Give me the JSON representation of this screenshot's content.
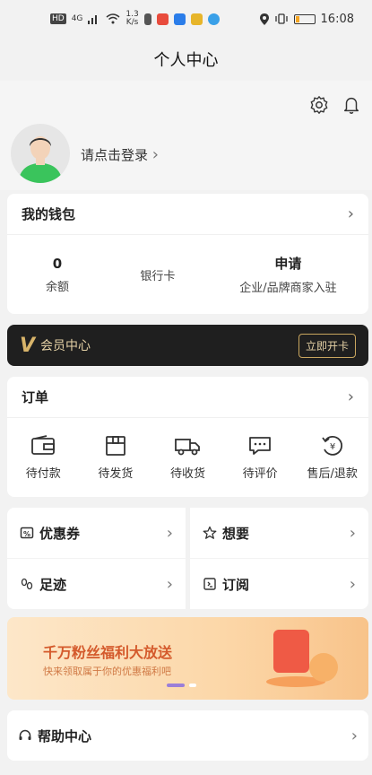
{
  "status": {
    "network": "HD",
    "signal": "4G",
    "speed_value": "1.3",
    "speed_unit": "K/s",
    "time": "16:08",
    "colors": {
      "app1": "#e84b3c",
      "app2": "#2b7de9",
      "app3": "#e7b52a",
      "app4": "#3aa0e8"
    }
  },
  "header": {
    "title": "个人中心"
  },
  "profile": {
    "login_text": "请点击登录",
    "colors": {
      "shirt": "#3ac45c",
      "skin": "#f3d3b9",
      "hair": "#333333"
    }
  },
  "wallet": {
    "title": "我的钱包",
    "items": [
      {
        "value": "0",
        "label": "余额"
      },
      {
        "value": "",
        "label": "银行卡"
      },
      {
        "value": "申请",
        "label": "企业/品牌商家入驻"
      }
    ]
  },
  "vip": {
    "logo": "V",
    "title": "会员中心",
    "button": "立即开卡"
  },
  "orders": {
    "title": "订单",
    "items": [
      {
        "label": "待付款",
        "icon": "wallet-icon"
      },
      {
        "label": "待发货",
        "icon": "box-icon"
      },
      {
        "label": "待收货",
        "icon": "truck-icon"
      },
      {
        "label": "待评价",
        "icon": "comment-icon"
      },
      {
        "label": "售后/退款",
        "icon": "refund-icon"
      }
    ]
  },
  "shortcuts": [
    {
      "label": "优惠券",
      "icon": "coupon-icon"
    },
    {
      "label": "想要",
      "icon": "star-icon"
    },
    {
      "label": "足迹",
      "icon": "footprint-icon"
    },
    {
      "label": "订阅",
      "icon": "subscribe-icon"
    }
  ],
  "banner": {
    "title": "千万粉丝福利大放送",
    "subtitle": "快来领取属于你的优惠福利吧"
  },
  "help": {
    "label": "帮助中心"
  }
}
